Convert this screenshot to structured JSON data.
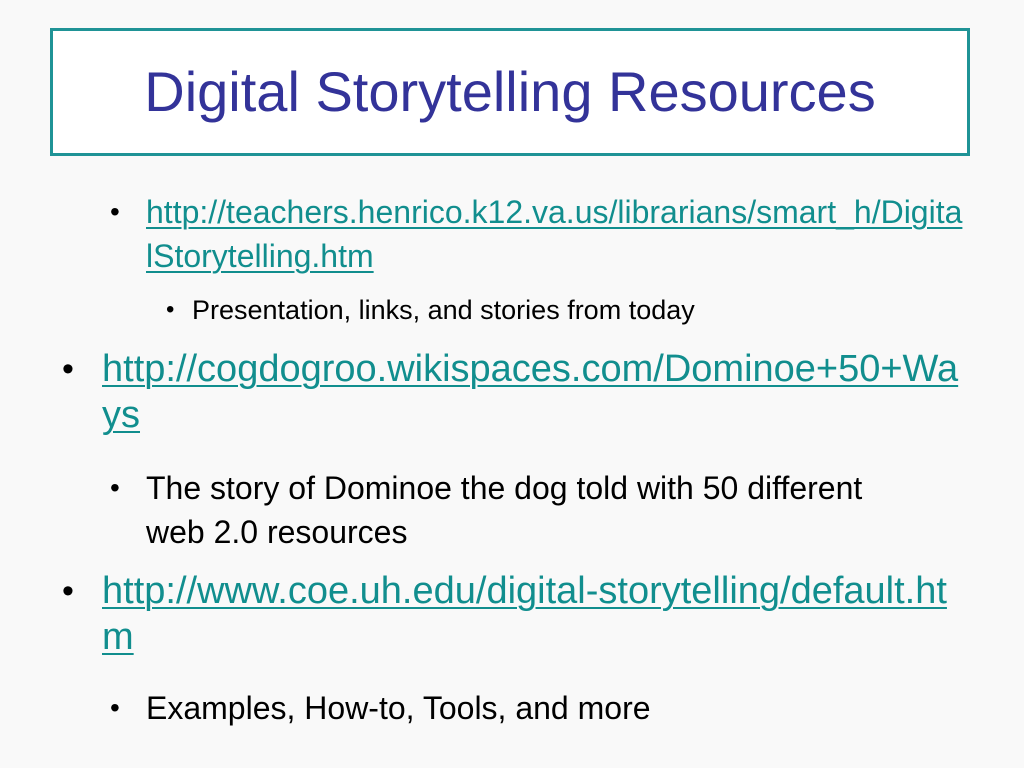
{
  "slide": {
    "title": "Digital Storytelling Resources",
    "bullet_char": "•",
    "items": [
      {
        "link": "http://teachers.henrico.k12.va.us/librarians/smart_h/DigitalStorytelling.htm",
        "description": "Presentation, links, and stories from today"
      },
      {
        "link": "http://cogdogroo.wikispaces.com/Dominoe+50+Ways",
        "description": "The story of Dominoe the dog told with 50 different web 2.0 resources"
      },
      {
        "link": "http://www.coe.uh.edu/digital-storytelling/default.htm",
        "description": "Examples, How-to, Tools, and more"
      }
    ]
  },
  "colors": {
    "title": "#333399",
    "title_border": "#1f9396",
    "link": "#118e8e",
    "background": "#f9f9f9"
  }
}
